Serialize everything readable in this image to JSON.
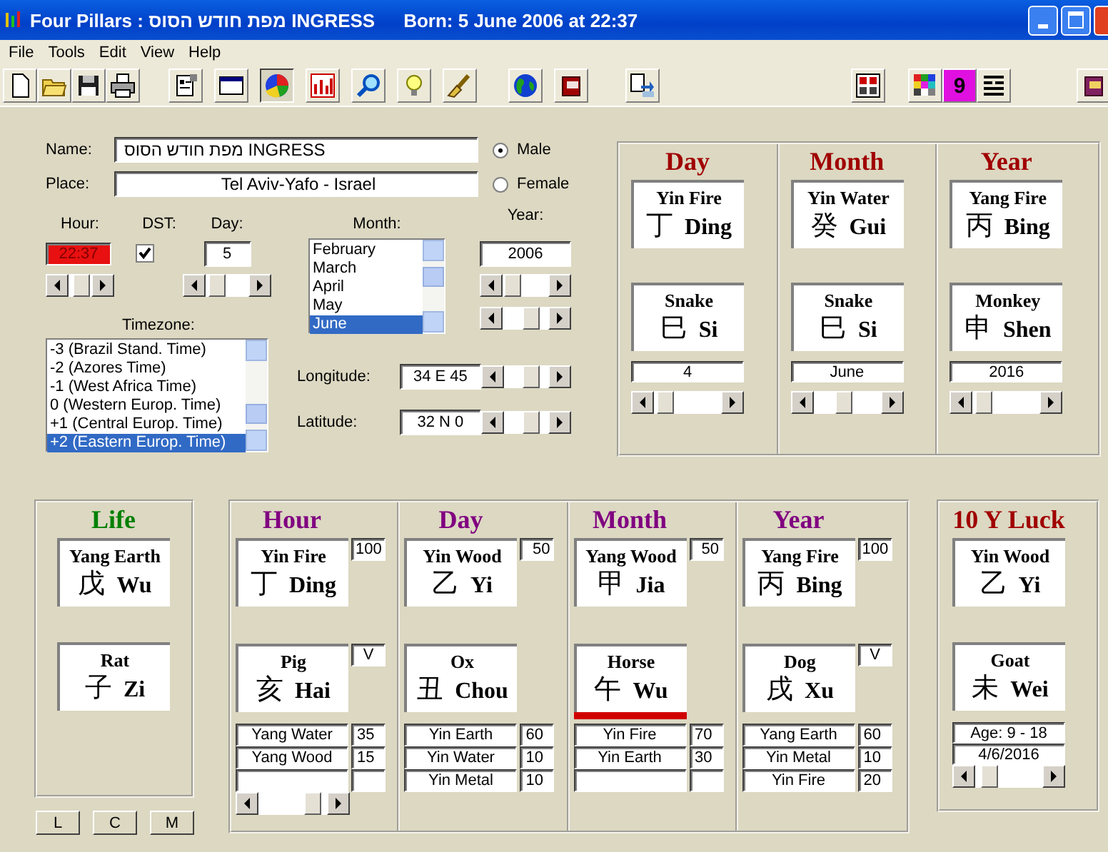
{
  "window": {
    "title": "Four Pillars : מפת חודש הסוס INGRESS",
    "born": "Born:  5 June 2006 at 22:37"
  },
  "menu": [
    "File",
    "Tools",
    "Edit",
    "View",
    "Help"
  ],
  "toolbar": [
    [
      {
        "selected": false
      },
      {
        "selected": false
      },
      {
        "selected": false
      },
      {
        "selected": false
      }
    ],
    [
      {
        "selected": false
      },
      {
        "selected": false
      },
      {
        "selected": true
      },
      {
        "selected": false
      },
      {
        "selected": false
      },
      {
        "selected": false
      },
      {
        "selected": false
      }
    ],
    [
      {
        "selected": false
      },
      {
        "selected": false
      }
    ],
    [
      {
        "selected": false
      }
    ],
    [
      {
        "selected": false
      }
    ],
    [
      {
        "selected": false
      },
      {
        "selected": false,
        "label": "9"
      },
      {
        "selected": false
      }
    ],
    [
      {
        "selected": false
      }
    ]
  ],
  "form": {
    "name": {
      "label": "Name:",
      "value": "מפת חודש הסוס INGRESS"
    },
    "place": {
      "label": "Place:",
      "value": "Tel Aviv-Yafo - Israel"
    },
    "gender": [
      {
        "label": "Male",
        "selected": true
      },
      {
        "label": "Female",
        "selected": false
      }
    ],
    "hour": {
      "label": "Hour:",
      "value": "22:37",
      "alert": true,
      "level": 0.85
    },
    "dst": {
      "label": "DST:",
      "checked": true
    },
    "day": {
      "label": "Day:",
      "value": "5",
      "level": 0.1
    },
    "month": {
      "label": "Month:",
      "items": [
        {
          "label": "February",
          "selected": false
        },
        {
          "label": "March",
          "selected": false
        },
        {
          "label": "April",
          "selected": false
        },
        {
          "label": "May",
          "selected": false
        },
        {
          "label": "June",
          "selected": true
        }
      ]
    },
    "year": {
      "label": "Year:",
      "value": "2006",
      "sliders": [
        {
          "level": 0.05
        },
        {
          "level": 0.7
        }
      ]
    },
    "timezone": {
      "label": "Timezone:",
      "items": [
        {
          "label": "-3 (Brazil Stand.  Time)",
          "selected": false
        },
        {
          "label": "-2 (Azores Time)",
          "selected": false
        },
        {
          "label": "-1 (West Africa Time)",
          "selected": false
        },
        {
          "label": "0 (Western Europ. Time)",
          "selected": false
        },
        {
          "label": "+1 (Central Europ. Time)",
          "selected": false
        },
        {
          "label": "+2 (Eastern Europ. Time)",
          "selected": true
        }
      ]
    },
    "longitude": {
      "label": "Longitude:",
      "value": "34 E 45",
      "level": 0.7
    },
    "latitude": {
      "label": "Latitude:",
      "value": "32 N 0",
      "level": 0.7
    }
  },
  "natal": [
    {
      "title": "Day",
      "stem": {
        "element": "Yin Fire",
        "hanzi": "丁",
        "pinyin": "Ding"
      },
      "branch": {
        "animal": "Snake",
        "hanzi": "巳",
        "pinyin": "Si"
      },
      "value": "4",
      "level": 0.05
    },
    {
      "title": "Month",
      "stem": {
        "element": "Yin Water",
        "hanzi": "癸",
        "pinyin": "Gui"
      },
      "branch": {
        "animal": "Snake",
        "hanzi": "巳",
        "pinyin": "Si"
      },
      "value": "June",
      "level": 0.45
    },
    {
      "title": "Year",
      "stem": {
        "element": "Yang Fire",
        "hanzi": "丙",
        "pinyin": "Bing"
      },
      "branch": {
        "animal": "Monkey",
        "hanzi": "申",
        "pinyin": "Shen"
      },
      "value": "2016",
      "level": 0.05
    }
  ],
  "life": {
    "title": "Life",
    "stem": {
      "element": "Yang Earth",
      "hanzi": "戊",
      "pinyin": "Wu"
    },
    "branch": {
      "animal": "Rat",
      "hanzi": "子",
      "pinyin": "Zi"
    }
  },
  "view_buttons": [
    "L",
    "C",
    "M"
  ],
  "pillars": [
    {
      "title": "Hour",
      "stem": {
        "element": "Yin Fire",
        "hanzi": "丁",
        "pinyin": "Ding"
      },
      "stem_score": "100",
      "branch": {
        "animal": "Pig",
        "hanzi": "亥",
        "pinyin": "Hai"
      },
      "branch_mark": "V",
      "highlighted": false,
      "hidden_stems": [
        {
          "element": "Yang Water",
          "score": "35"
        },
        {
          "element": "Yang Wood",
          "score": "15"
        }
      ],
      "level": 0.9
    },
    {
      "title": "Day",
      "stem": {
        "element": "Yin Wood",
        "hanzi": "乙",
        "pinyin": "Yi"
      },
      "stem_score": "50",
      "branch": {
        "animal": "Ox",
        "hanzi": "丑",
        "pinyin": "Chou"
      },
      "highlighted": false,
      "hidden_stems": [
        {
          "element": "Yin Earth",
          "score": "60"
        },
        {
          "element": "Yin Water",
          "score": "10"
        },
        {
          "element": "Yin Metal",
          "score": "10"
        }
      ]
    },
    {
      "title": "Month",
      "stem": {
        "element": "Yang Wood",
        "hanzi": "甲",
        "pinyin": "Jia"
      },
      "stem_score": "50",
      "branch": {
        "animal": "Horse",
        "hanzi": "午",
        "pinyin": "Wu"
      },
      "highlighted": true,
      "hidden_stems": [
        {
          "element": "Yin Fire",
          "score": "70"
        },
        {
          "element": "Yin Earth",
          "score": "30"
        }
      ]
    },
    {
      "title": "Year",
      "stem": {
        "element": "Yang Fire",
        "hanzi": "丙",
        "pinyin": "Bing"
      },
      "stem_score": "100",
      "branch": {
        "animal": "Dog",
        "hanzi": "戌",
        "pinyin": "Xu"
      },
      "branch_mark": "V",
      "highlighted": false,
      "hidden_stems": [
        {
          "element": "Yang Earth",
          "score": "60"
        },
        {
          "element": "Yin Metal",
          "score": "10"
        },
        {
          "element": "Yin Fire",
          "score": "20"
        }
      ]
    }
  ],
  "luck": {
    "title": "10 Y Luck",
    "stem": {
      "element": "Yin Wood",
      "hanzi": "乙",
      "pinyin": "Yi"
    },
    "branch": {
      "animal": "Goat",
      "hanzi": "未",
      "pinyin": "Wei"
    },
    "age": "Age: 9 - 18",
    "date": "4/6/2016",
    "level": 0.1
  }
}
